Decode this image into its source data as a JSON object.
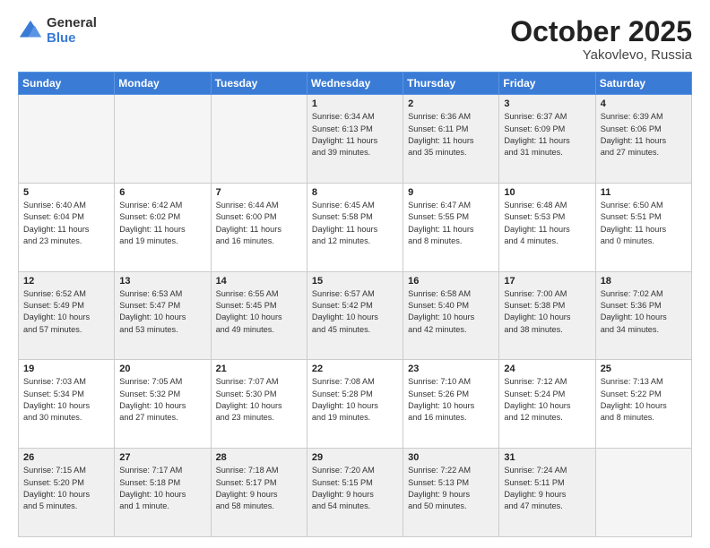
{
  "header": {
    "logo_general": "General",
    "logo_blue": "Blue",
    "month": "October 2025",
    "location": "Yakovlevo, Russia"
  },
  "days_of_week": [
    "Sunday",
    "Monday",
    "Tuesday",
    "Wednesday",
    "Thursday",
    "Friday",
    "Saturday"
  ],
  "weeks": [
    [
      {
        "num": "",
        "info": "",
        "empty": true
      },
      {
        "num": "",
        "info": "",
        "empty": true
      },
      {
        "num": "",
        "info": "",
        "empty": true
      },
      {
        "num": "1",
        "info": "Sunrise: 6:34 AM\nSunset: 6:13 PM\nDaylight: 11 hours\nand 39 minutes."
      },
      {
        "num": "2",
        "info": "Sunrise: 6:36 AM\nSunset: 6:11 PM\nDaylight: 11 hours\nand 35 minutes."
      },
      {
        "num": "3",
        "info": "Sunrise: 6:37 AM\nSunset: 6:09 PM\nDaylight: 11 hours\nand 31 minutes."
      },
      {
        "num": "4",
        "info": "Sunrise: 6:39 AM\nSunset: 6:06 PM\nDaylight: 11 hours\nand 27 minutes."
      }
    ],
    [
      {
        "num": "5",
        "info": "Sunrise: 6:40 AM\nSunset: 6:04 PM\nDaylight: 11 hours\nand 23 minutes."
      },
      {
        "num": "6",
        "info": "Sunrise: 6:42 AM\nSunset: 6:02 PM\nDaylight: 11 hours\nand 19 minutes."
      },
      {
        "num": "7",
        "info": "Sunrise: 6:44 AM\nSunset: 6:00 PM\nDaylight: 11 hours\nand 16 minutes."
      },
      {
        "num": "8",
        "info": "Sunrise: 6:45 AM\nSunset: 5:58 PM\nDaylight: 11 hours\nand 12 minutes."
      },
      {
        "num": "9",
        "info": "Sunrise: 6:47 AM\nSunset: 5:55 PM\nDaylight: 11 hours\nand 8 minutes."
      },
      {
        "num": "10",
        "info": "Sunrise: 6:48 AM\nSunset: 5:53 PM\nDaylight: 11 hours\nand 4 minutes."
      },
      {
        "num": "11",
        "info": "Sunrise: 6:50 AM\nSunset: 5:51 PM\nDaylight: 11 hours\nand 0 minutes."
      }
    ],
    [
      {
        "num": "12",
        "info": "Sunrise: 6:52 AM\nSunset: 5:49 PM\nDaylight: 10 hours\nand 57 minutes."
      },
      {
        "num": "13",
        "info": "Sunrise: 6:53 AM\nSunset: 5:47 PM\nDaylight: 10 hours\nand 53 minutes."
      },
      {
        "num": "14",
        "info": "Sunrise: 6:55 AM\nSunset: 5:45 PM\nDaylight: 10 hours\nand 49 minutes."
      },
      {
        "num": "15",
        "info": "Sunrise: 6:57 AM\nSunset: 5:42 PM\nDaylight: 10 hours\nand 45 minutes."
      },
      {
        "num": "16",
        "info": "Sunrise: 6:58 AM\nSunset: 5:40 PM\nDaylight: 10 hours\nand 42 minutes."
      },
      {
        "num": "17",
        "info": "Sunrise: 7:00 AM\nSunset: 5:38 PM\nDaylight: 10 hours\nand 38 minutes."
      },
      {
        "num": "18",
        "info": "Sunrise: 7:02 AM\nSunset: 5:36 PM\nDaylight: 10 hours\nand 34 minutes."
      }
    ],
    [
      {
        "num": "19",
        "info": "Sunrise: 7:03 AM\nSunset: 5:34 PM\nDaylight: 10 hours\nand 30 minutes."
      },
      {
        "num": "20",
        "info": "Sunrise: 7:05 AM\nSunset: 5:32 PM\nDaylight: 10 hours\nand 27 minutes."
      },
      {
        "num": "21",
        "info": "Sunrise: 7:07 AM\nSunset: 5:30 PM\nDaylight: 10 hours\nand 23 minutes."
      },
      {
        "num": "22",
        "info": "Sunrise: 7:08 AM\nSunset: 5:28 PM\nDaylight: 10 hours\nand 19 minutes."
      },
      {
        "num": "23",
        "info": "Sunrise: 7:10 AM\nSunset: 5:26 PM\nDaylight: 10 hours\nand 16 minutes."
      },
      {
        "num": "24",
        "info": "Sunrise: 7:12 AM\nSunset: 5:24 PM\nDaylight: 10 hours\nand 12 minutes."
      },
      {
        "num": "25",
        "info": "Sunrise: 7:13 AM\nSunset: 5:22 PM\nDaylight: 10 hours\nand 8 minutes."
      }
    ],
    [
      {
        "num": "26",
        "info": "Sunrise: 7:15 AM\nSunset: 5:20 PM\nDaylight: 10 hours\nand 5 minutes."
      },
      {
        "num": "27",
        "info": "Sunrise: 7:17 AM\nSunset: 5:18 PM\nDaylight: 10 hours\nand 1 minute."
      },
      {
        "num": "28",
        "info": "Sunrise: 7:18 AM\nSunset: 5:17 PM\nDaylight: 9 hours\nand 58 minutes."
      },
      {
        "num": "29",
        "info": "Sunrise: 7:20 AM\nSunset: 5:15 PM\nDaylight: 9 hours\nand 54 minutes."
      },
      {
        "num": "30",
        "info": "Sunrise: 7:22 AM\nSunset: 5:13 PM\nDaylight: 9 hours\nand 50 minutes."
      },
      {
        "num": "31",
        "info": "Sunrise: 7:24 AM\nSunset: 5:11 PM\nDaylight: 9 hours\nand 47 minutes."
      },
      {
        "num": "",
        "info": "",
        "empty": true
      }
    ]
  ]
}
